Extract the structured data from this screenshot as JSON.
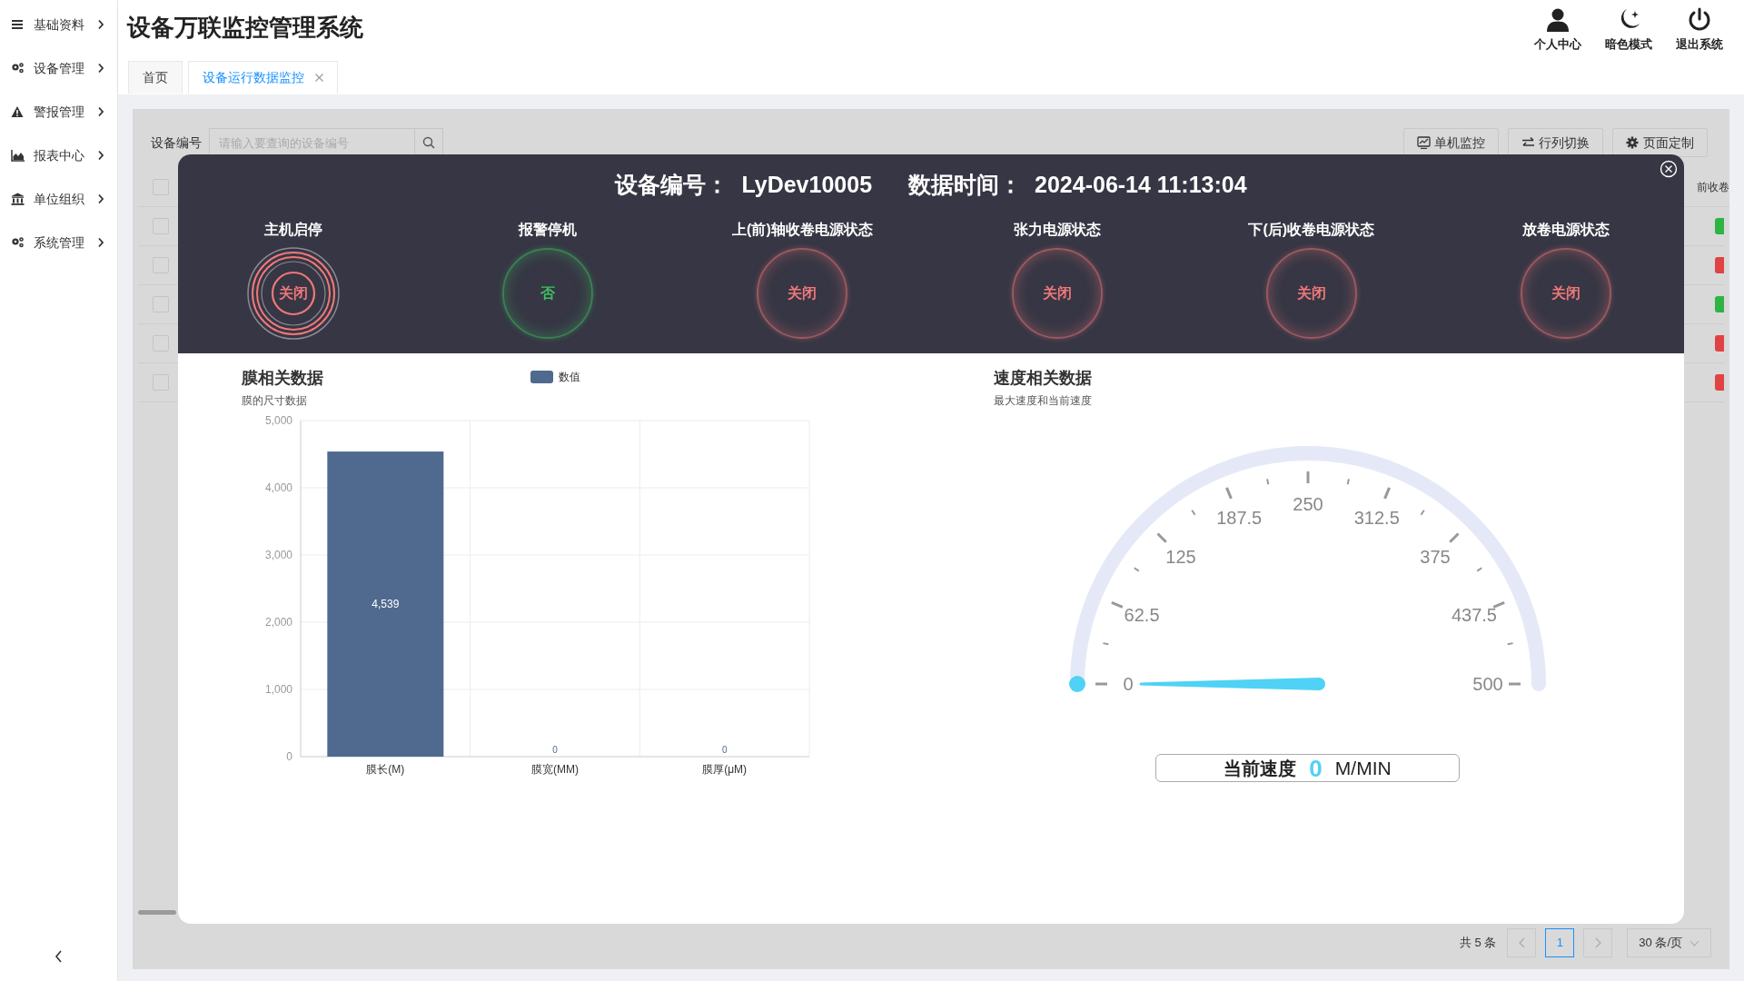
{
  "sidebar": {
    "items": [
      {
        "label": "基础资料"
      },
      {
        "label": "设备管理"
      },
      {
        "label": "警报管理"
      },
      {
        "label": "报表中心"
      },
      {
        "label": "单位组织"
      },
      {
        "label": "系统管理"
      }
    ]
  },
  "header": {
    "title": "设备万联监控管理系统",
    "actions": [
      {
        "label": "个人中心"
      },
      {
        "label": "暗色模式"
      },
      {
        "label": "退出系统"
      }
    ]
  },
  "tabs": [
    {
      "label": "首页",
      "selected": false,
      "closable": false
    },
    {
      "label": "设备运行数据监控",
      "selected": true,
      "closable": true
    }
  ],
  "toolbar": {
    "filter_label": "设备编号",
    "search": {
      "placeholder": "请输入要查询的设备编号"
    },
    "buttons": [
      "单机监控",
      "行列切换",
      "页面定制"
    ]
  },
  "table": {
    "header": {
      "checked": false,
      "column_fragment": "前收卷"
    },
    "rows": [
      {
        "checked": false,
        "color": "#2fb344"
      },
      {
        "checked": false,
        "color": "#e04343"
      },
      {
        "checked": false,
        "color": "#2fb344"
      },
      {
        "checked": false,
        "color": "#e04343"
      },
      {
        "checked": false,
        "color": "#e04343"
      }
    ]
  },
  "pagination": {
    "total": "共 5 条",
    "pages": [
      {
        "label": "1",
        "selected": true
      }
    ],
    "page_size": "30 条/页"
  },
  "modal": {
    "title": [
      {
        "label": "设备编号：",
        "value": "LyDev10005"
      },
      {
        "label": "数据时间：",
        "value": "2024-06-14 11:13:04"
      }
    ],
    "statuses": [
      {
        "label": "主机启停",
        "value": "关闭",
        "kind": "rings",
        "color": "#f07878"
      },
      {
        "label": "报警停机",
        "value": "否",
        "kind": "glow",
        "color": "#3fbf5f"
      },
      {
        "label": "上(前)轴收卷电源状态",
        "value": "关闭",
        "kind": "glow",
        "color": "#f07878"
      },
      {
        "label": "张力电源状态",
        "value": "关闭",
        "kind": "glow",
        "color": "#f07878"
      },
      {
        "label": "下(后)收卷电源状态",
        "value": "关闭",
        "kind": "glow",
        "color": "#f07878"
      },
      {
        "label": "放卷电源状态",
        "value": "关闭",
        "kind": "glow",
        "color": "#f07878"
      }
    ],
    "film_panel": {
      "title": "膜相关数据",
      "subtitle": "膜的尺寸数据",
      "chart_data": {
        "type": "bar",
        "categories": [
          "膜长(M)",
          "膜宽(MM)",
          "膜厚(μM)"
        ],
        "series": [
          {
            "name": "数值",
            "color": "#50698f",
            "values": [
              4539,
              0,
              0
            ]
          }
        ],
        "ylim": [
          0,
          5000
        ],
        "yticks": [
          {
            "value": 0,
            "label": "0"
          },
          {
            "value": 1000,
            "label": "1,000"
          },
          {
            "value": 2000,
            "label": "2,000"
          },
          {
            "value": 3000,
            "label": "3,000"
          },
          {
            "value": 4000,
            "label": "4,000"
          },
          {
            "value": 5000,
            "label": "5,000"
          }
        ],
        "value_labels": [
          "4,539",
          "0",
          "0"
        ],
        "grid": true
      }
    },
    "speed_panel": {
      "title": "速度相关数据",
      "subtitle": "最大速度和当前速度",
      "gauge": {
        "ticks": [
          "0",
          "62.5",
          "125",
          "187.5",
          "250",
          "312.5",
          "375",
          "437.5",
          "500"
        ],
        "level": 0
      },
      "readout": {
        "label": "当前速度",
        "value": "0",
        "unit": "M/MIN"
      }
    }
  }
}
